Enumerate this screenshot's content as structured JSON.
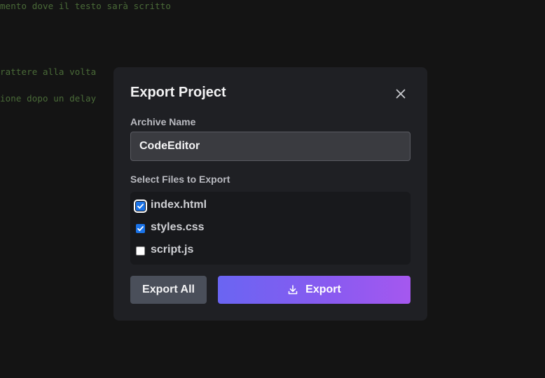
{
  "background_code": {
    "lines": [
      "mento dove il testo sarà scritto",
      "rattere alla volta",
      "ione dopo un delay"
    ]
  },
  "dialog": {
    "title": "Export Project",
    "close_icon": "close-icon",
    "archive_name_label": "Archive Name",
    "archive_name_value": "CodeEditor",
    "select_files_label": "Select Files to Export",
    "files": [
      {
        "name": "index.html",
        "checked": true
      },
      {
        "name": "styles.css",
        "checked": true
      },
      {
        "name": "script.js",
        "checked": false
      }
    ],
    "export_all_label": "Export All",
    "export_label": "Export",
    "export_icon": "download-icon"
  },
  "colors": {
    "background": "#141414",
    "dialog_bg": "#1f2024",
    "export_gradient_start": "#6a65f2",
    "export_gradient_end": "#a558ef",
    "checkbox_accent": "#1a73e8",
    "code_comment": "#4a6b38"
  }
}
